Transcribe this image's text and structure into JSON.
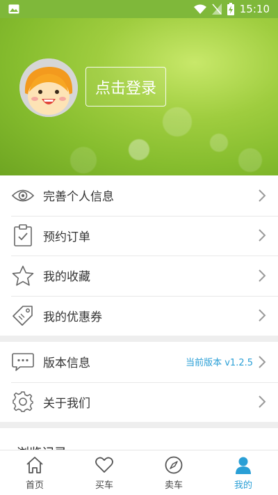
{
  "status_bar": {
    "time": "15:10"
  },
  "header": {
    "login_label": "点击登录"
  },
  "menu_main": [
    {
      "label": "完善个人信息",
      "icon": "eye-icon"
    },
    {
      "label": "预约订单",
      "icon": "clipboard-check-icon"
    },
    {
      "label": "我的收藏",
      "icon": "star-icon"
    },
    {
      "label": "我的优惠券",
      "icon": "tag-icon"
    }
  ],
  "menu_other": [
    {
      "label": "版本信息",
      "icon": "chat-icon",
      "extra": "当前版本 v1.2.5"
    },
    {
      "label": "关于我们",
      "icon": "gear-icon"
    }
  ],
  "partial_section": {
    "title": "浏览记录"
  },
  "tabs": [
    {
      "label": "首页",
      "icon": "home-icon"
    },
    {
      "label": "买车",
      "icon": "heart-icon"
    },
    {
      "label": "卖车",
      "icon": "compass-icon"
    },
    {
      "label": "我的",
      "icon": "person-icon",
      "active": true
    }
  ],
  "colors": {
    "accent": "#2a9fd6",
    "hero_green": "#86bd2e"
  }
}
